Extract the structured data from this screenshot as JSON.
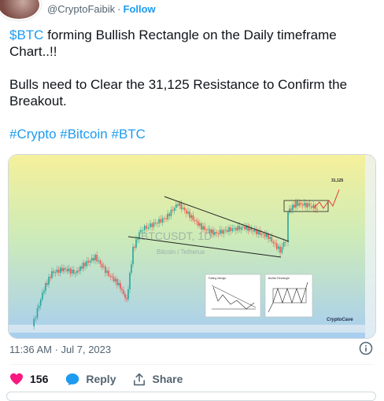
{
  "author": {
    "handle": "@CryptoFaibik",
    "separator": "·",
    "follow_label": "Follow"
  },
  "tweet": {
    "cashtag": "$BTC",
    "line1_rest": " forming Bullish Rectangle on the Daily timeframe Chart..!!",
    "line2": "Bulls need to Clear the 31,125 Resistance to Confirm the Breakout.",
    "hashtags": [
      "#Crypto",
      "#Bitcoin",
      "#BTC"
    ]
  },
  "media": {
    "watermark_symbol": "BTCUSDT, 1D",
    "watermark_name": "Bitcoin / Tetherus",
    "target_label": "31,125",
    "inset_left_title": "Falling Wedge",
    "inset_right_title": "Bullish Rectangle",
    "brand": "CryptoCave",
    "colors": {
      "up": "#26a69a",
      "down": "#ef5350",
      "target": "#e53935",
      "bg_top": "#f5f09a",
      "bg_mid": "#bfe8c8",
      "bg_bottom": "#a8cef0"
    }
  },
  "meta": {
    "timestamp": "11:36 AM · Jul 7, 2023"
  },
  "actions": {
    "like_count": "156",
    "reply_label": "Reply",
    "share_label": "Share"
  },
  "icons": {
    "info": "info-icon",
    "like": "heart-icon",
    "reply": "reply-bubble-icon",
    "share": "share-icon"
  }
}
